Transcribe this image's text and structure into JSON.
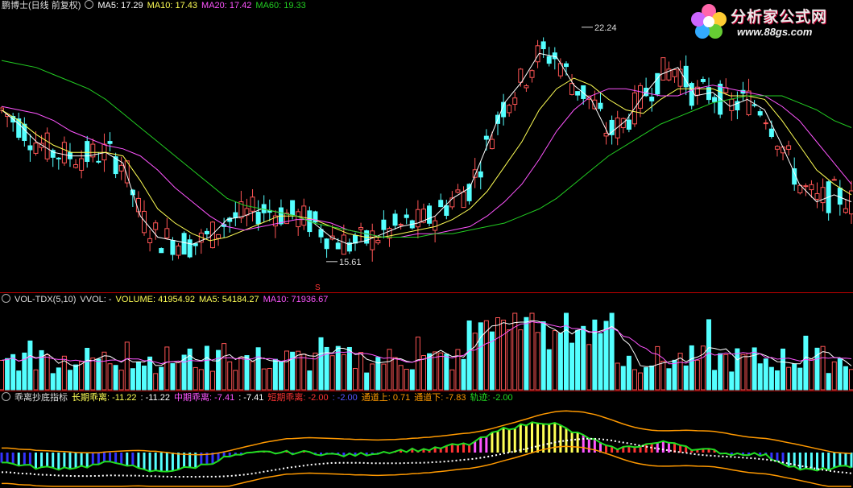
{
  "colors": {
    "up": "#ff5555",
    "down": "#54ffff",
    "ma5": "#ffffff",
    "ma10": "#ffff55",
    "ma20": "#ff55ff",
    "ma60": "#22cc22",
    "sep": "#c00000",
    "orange": "#ff9900"
  },
  "main_header": {
    "title": "鹏博士(日线 前复权)",
    "ma5": "MA5: 17.29",
    "ma10": "MA10: 17.43",
    "ma20": "MA20: 17.42",
    "ma60": "MA60: 19.33"
  },
  "vol_header": {
    "name": "VOL-TDX(5,10)",
    "vvol": "VVOL: -",
    "volume": "VOLUME: 41954.92",
    "ma5": "MA5: 54184.27",
    "ma10": "MA10: 71936.67"
  },
  "ind_header": {
    "name": "乖离抄底指标",
    "long": "长期乖离: -11.22",
    "long_b": ": -11.22",
    "mid": "中期乖离: -7.41",
    "mid_b": ": -7.41",
    "short": "短期乖离: -2.00",
    "short_b": ": -2.00",
    "up": "通道上: 0.71",
    "down": "通道下: -7.83",
    "track": "轨迹: -2.00"
  },
  "annotations": {
    "high": "22.24",
    "low": "15.61",
    "marker": "S"
  },
  "logo": {
    "name": "分析家公式网",
    "url": "www.88gs.com"
  },
  "chart_data": [
    {
      "type": "line",
      "title": "鹏博士(日线 前复权)",
      "note": "daily candlestick price chart with moving averages",
      "y_annotations": {
        "high": 22.24,
        "low": 15.61
      },
      "series": [
        {
          "name": "MA5",
          "last": 17.29,
          "values": [
            19.9,
            19.5,
            19.0,
            18.7,
            18.6,
            18.6,
            18.7,
            18.4,
            16.9,
            16.3,
            16.2,
            16.1,
            16.3,
            16.8,
            16.9,
            17.1,
            17.0,
            16.9,
            16.7,
            16.3,
            16.1,
            16.2,
            16.4,
            16.6,
            16.7,
            16.9,
            17.4,
            17.7,
            18.9,
            20.1,
            20.7,
            21.5,
            21.4,
            20.6,
            20.2,
            19.2,
            19.6,
            20.3,
            20.9,
            21.1,
            20.3,
            20.4,
            20.0,
            20.2,
            19.9,
            18.9,
            17.8,
            17.3,
            17.5,
            17.3
          ]
        },
        {
          "name": "MA10",
          "last": 17.43,
          "values": [
            19.9,
            19.6,
            19.2,
            18.9,
            18.7,
            18.7,
            18.7,
            18.6,
            17.9,
            17.1,
            16.7,
            16.4,
            16.2,
            16.3,
            16.5,
            16.7,
            16.9,
            16.9,
            16.8,
            16.6,
            16.4,
            16.3,
            16.3,
            16.4,
            16.5,
            16.6,
            16.8,
            17.1,
            17.6,
            18.3,
            19.0,
            19.9,
            20.5,
            20.8,
            20.6,
            20.2,
            19.9,
            19.8,
            20.2,
            20.5,
            20.5,
            20.5,
            20.3,
            20.3,
            20.2,
            19.6,
            18.9,
            18.2,
            17.8,
            17.5
          ]
        },
        {
          "name": "MA20",
          "last": 17.42,
          "values": [
            20.0,
            19.9,
            19.8,
            19.6,
            19.3,
            19.1,
            18.9,
            18.8,
            18.6,
            18.2,
            17.7,
            17.3,
            16.9,
            16.6,
            16.5,
            16.6,
            16.7,
            16.8,
            16.8,
            16.7,
            16.5,
            16.4,
            16.3,
            16.3,
            16.4,
            16.4,
            16.5,
            16.6,
            16.9,
            17.3,
            17.8,
            18.5,
            19.3,
            19.9,
            20.3,
            20.5,
            20.5,
            20.4,
            20.3,
            20.3,
            20.5,
            20.6,
            20.5,
            20.4,
            20.3,
            20.0,
            19.6,
            19.0,
            18.4,
            17.8
          ]
        },
        {
          "name": "MA60",
          "last": 19.33,
          "values": [
            21.3,
            21.2,
            21.1,
            20.9,
            20.7,
            20.5,
            20.2,
            19.8,
            19.4,
            19.0,
            18.6,
            18.2,
            17.8,
            17.4,
            17.2,
            17.1,
            17.0,
            16.9,
            16.7,
            16.6,
            16.5,
            16.4,
            16.3,
            16.3,
            16.3,
            16.4,
            16.4,
            16.5,
            16.6,
            16.7,
            16.9,
            17.1,
            17.4,
            17.8,
            18.2,
            18.6,
            18.9,
            19.2,
            19.5,
            19.7,
            19.9,
            20.1,
            20.2,
            20.3,
            20.3,
            20.3,
            20.1,
            19.9,
            19.6,
            19.4
          ]
        }
      ]
    },
    {
      "type": "bar",
      "title": "VOL-TDX(5,10)",
      "series": [
        {
          "name": "VOLUME",
          "last": 41954.92
        },
        {
          "name": "MA5",
          "last": 54184.27
        },
        {
          "name": "MA10",
          "last": 71936.67
        }
      ]
    },
    {
      "type": "bar",
      "title": "乖离抄底指标",
      "series": [
        {
          "name": "长期乖离",
          "last": -11.22
        },
        {
          "name": "中期乖离",
          "last": -7.41
        },
        {
          "name": "短期乖离",
          "last": -2.0
        },
        {
          "name": "通道上",
          "last": 0.71
        },
        {
          "name": "通道下",
          "last": -7.83
        },
        {
          "name": "轨迹",
          "last": -2.0
        }
      ]
    }
  ]
}
